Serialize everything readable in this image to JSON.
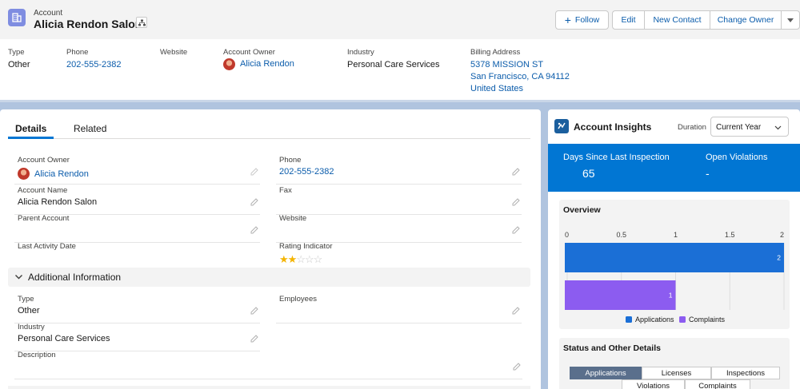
{
  "header": {
    "object_type": "Account",
    "account_name": "Alicia Rendon Salon",
    "buttons": {
      "follow": "Follow",
      "edit": "Edit",
      "new_contact": "New Contact",
      "change_owner": "Change Owner"
    },
    "fields": {
      "type": {
        "label": "Type",
        "value": "Other"
      },
      "phone": {
        "label": "Phone",
        "value": "202-555-2382"
      },
      "website": {
        "label": "Website",
        "value": ""
      },
      "owner": {
        "label": "Account Owner",
        "value": "Alicia Rendon"
      },
      "industry": {
        "label": "Industry",
        "value": "Personal Care Services"
      },
      "billing": {
        "label": "Billing Address",
        "line1": "5378 MISSION ST",
        "line2": "San Francisco, CA 94112",
        "line3": "United States"
      }
    }
  },
  "tabs": {
    "details": "Details",
    "related": "Related"
  },
  "details": {
    "account_owner": {
      "label": "Account Owner",
      "value": "Alicia Rendon"
    },
    "phone": {
      "label": "Phone",
      "value": "202-555-2382"
    },
    "account_name": {
      "label": "Account Name",
      "value": "Alicia Rendon Salon"
    },
    "fax": {
      "label": "Fax",
      "value": ""
    },
    "parent_account": {
      "label": "Parent Account",
      "value": ""
    },
    "website": {
      "label": "Website",
      "value": ""
    },
    "last_activity": {
      "label": "Last Activity Date",
      "value": ""
    },
    "rating": {
      "label": "Rating Indicator",
      "stars": 2,
      "max": 5
    }
  },
  "additional": {
    "title": "Additional Information",
    "type": {
      "label": "Type",
      "value": "Other"
    },
    "employees": {
      "label": "Employees",
      "value": ""
    },
    "industry": {
      "label": "Industry",
      "value": "Personal Care Services"
    },
    "description": {
      "label": "Description",
      "value": ""
    }
  },
  "insights": {
    "title": "Account Insights",
    "duration_label": "Duration",
    "duration_value": "Current Year",
    "stats": {
      "days_label": "Days Since Last Inspection",
      "days_value": "65",
      "violations_label": "Open Violations",
      "violations_value": "-"
    },
    "overview_title": "Overview",
    "status_title": "Status and Other Details",
    "status_tabs": [
      "Applications",
      "Licenses",
      "Inspections",
      "Violations",
      "Complaints"
    ]
  },
  "chart_data": {
    "type": "bar",
    "orientation": "horizontal",
    "categories": [
      "Applications",
      "Complaints"
    ],
    "values": [
      2,
      1
    ],
    "colors": [
      "#1b6fd6",
      "#8c5cf0"
    ],
    "x_ticks": [
      "0",
      "0.5",
      "1",
      "1.5",
      "2"
    ],
    "xlim": [
      0,
      2
    ],
    "legend": [
      "Applications",
      "Complaints"
    ],
    "legend_position": "bottom",
    "data_labels": [
      "2",
      "1"
    ]
  },
  "colors": {
    "brand": "#0176d3",
    "link": "#0b5cab",
    "page_bg": "#b0c4df"
  }
}
